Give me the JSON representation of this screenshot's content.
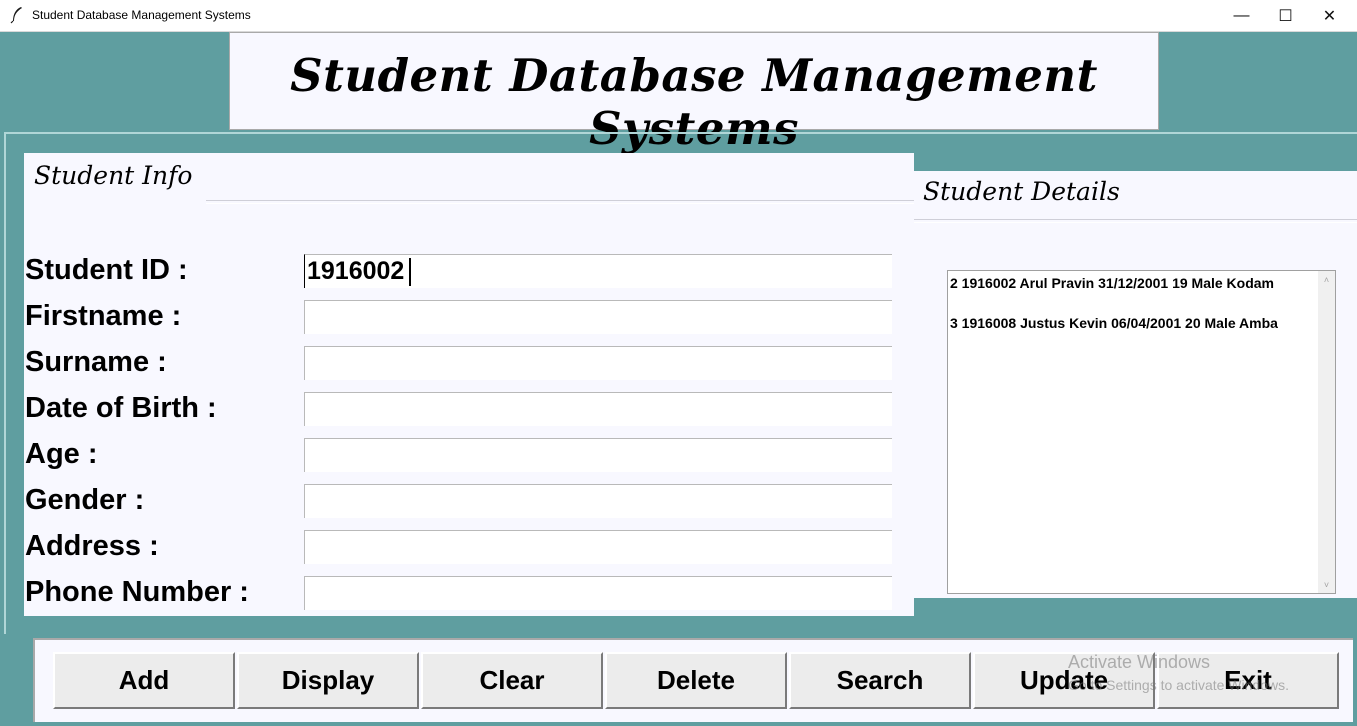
{
  "window": {
    "title": "Student Database Management Systems",
    "icon": "feather-icon",
    "minimize": "—",
    "maximize": "☐",
    "close": "✕"
  },
  "header": {
    "title": "Student Database Management Systems"
  },
  "student_info": {
    "title": "Student Info",
    "fields": [
      {
        "label": "Student ID :",
        "value": "1916002"
      },
      {
        "label": "Firstname :",
        "value": ""
      },
      {
        "label": "Surname :",
        "value": ""
      },
      {
        "label": "Date of Birth :",
        "value": ""
      },
      {
        "label": "Age :",
        "value": ""
      },
      {
        "label": "Gender :",
        "value": ""
      },
      {
        "label": "Address :",
        "value": ""
      },
      {
        "label": "Phone Number :",
        "value": ""
      }
    ]
  },
  "student_details": {
    "title": "Student Details",
    "records": [
      "2 1916002 Arul Pravin 31/12/2001 19 Male Kodam",
      "3 1916008 Justus Kevin 06/04/2001 20 Male Amba"
    ],
    "scroll_up": "˄",
    "scroll_down": "˅"
  },
  "buttons": [
    "Add",
    "Display",
    "Clear",
    "Delete",
    "Search",
    "Update",
    "Exit"
  ],
  "watermark": {
    "line1": "Activate Windows",
    "line2": "Go to Settings to activate Windows."
  },
  "colors": {
    "background": "#5f9ea0",
    "panel": "#f8f8ff",
    "button": "#ececec"
  }
}
